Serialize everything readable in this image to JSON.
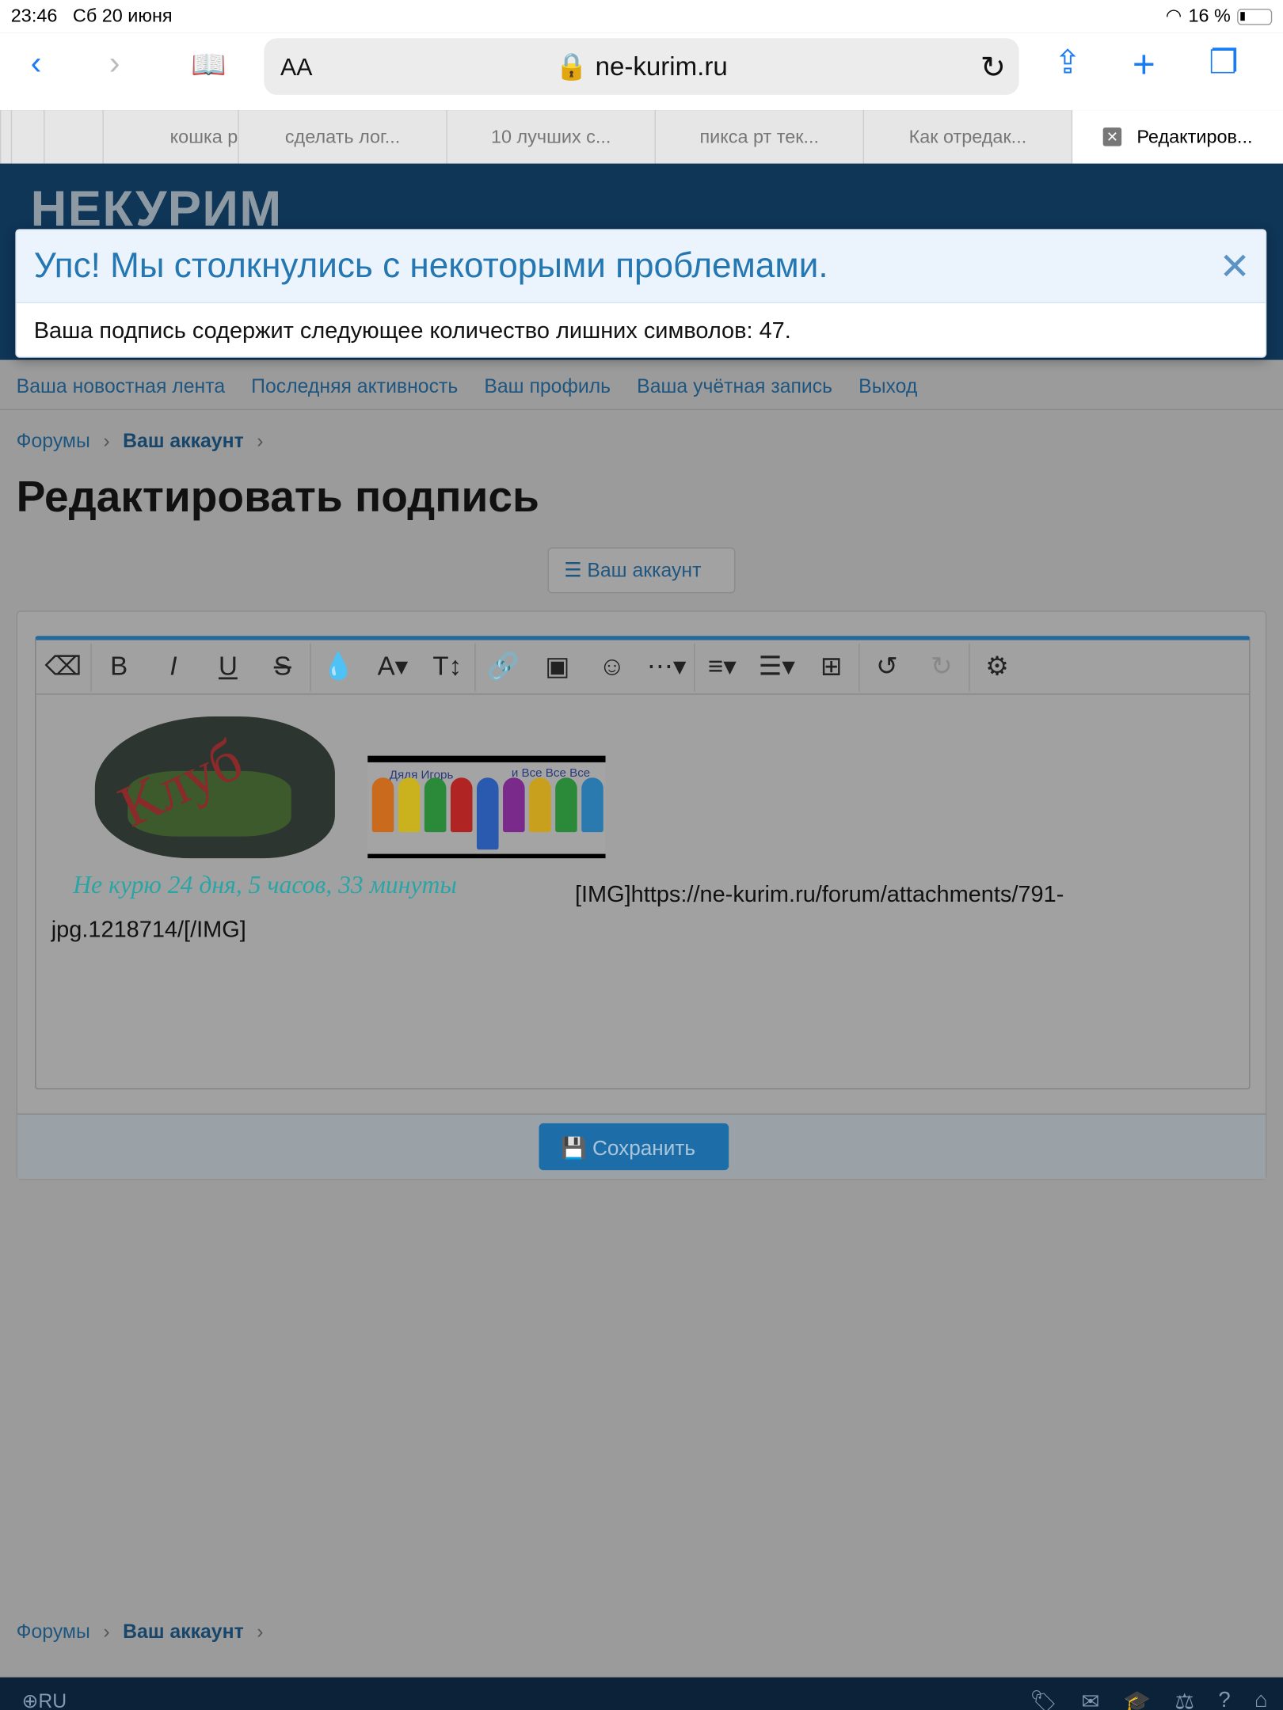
{
  "status": {
    "time": "23:46",
    "date": "Сб 20 июня",
    "battery": "16 %"
  },
  "browser": {
    "text_size": "AA",
    "domain": "ne-kurim.ru"
  },
  "tabs": [
    "",
    "",
    "кошка р",
    "сделать лог...",
    "10 лучших с...",
    "пикса рт тек...",
    "Как отредак...",
    "Редактиров..."
  ],
  "site": {
    "logo": "НЕКУРИМ"
  },
  "alert": {
    "title": "Упс! Мы столкнулись с некоторыми проблемами.",
    "message": "Ваша подпись содержит следующее количество лишних символов: 47."
  },
  "nav": [
    "Ваша новостная лента",
    "Последняя активность",
    "Ваш профиль",
    "Ваша учётная запись",
    "Выход"
  ],
  "breadcrumb": {
    "forums": "Форумы",
    "account": "Ваш аккаунт"
  },
  "page_title": "Редактировать подпись",
  "account_button": "Ваш аккаунт",
  "editor": {
    "image1_text": "Клуб",
    "image2_left": "Дядя Игорь",
    "image2_right": "и Все Все Все",
    "counter": "Не курю  24 дня, 5 часов, 33 минуты",
    "text": "[IMG]https://ne-kurim.ru/forum/attachments/791-jpg.1218714/[/IMG]"
  },
  "save_label": "Сохранить",
  "footer": {
    "language": "RU"
  },
  "colors": {
    "header": "#0f3557",
    "link": "#1f567f",
    "accent": "#24689c",
    "alert_title": "#2577b1"
  }
}
